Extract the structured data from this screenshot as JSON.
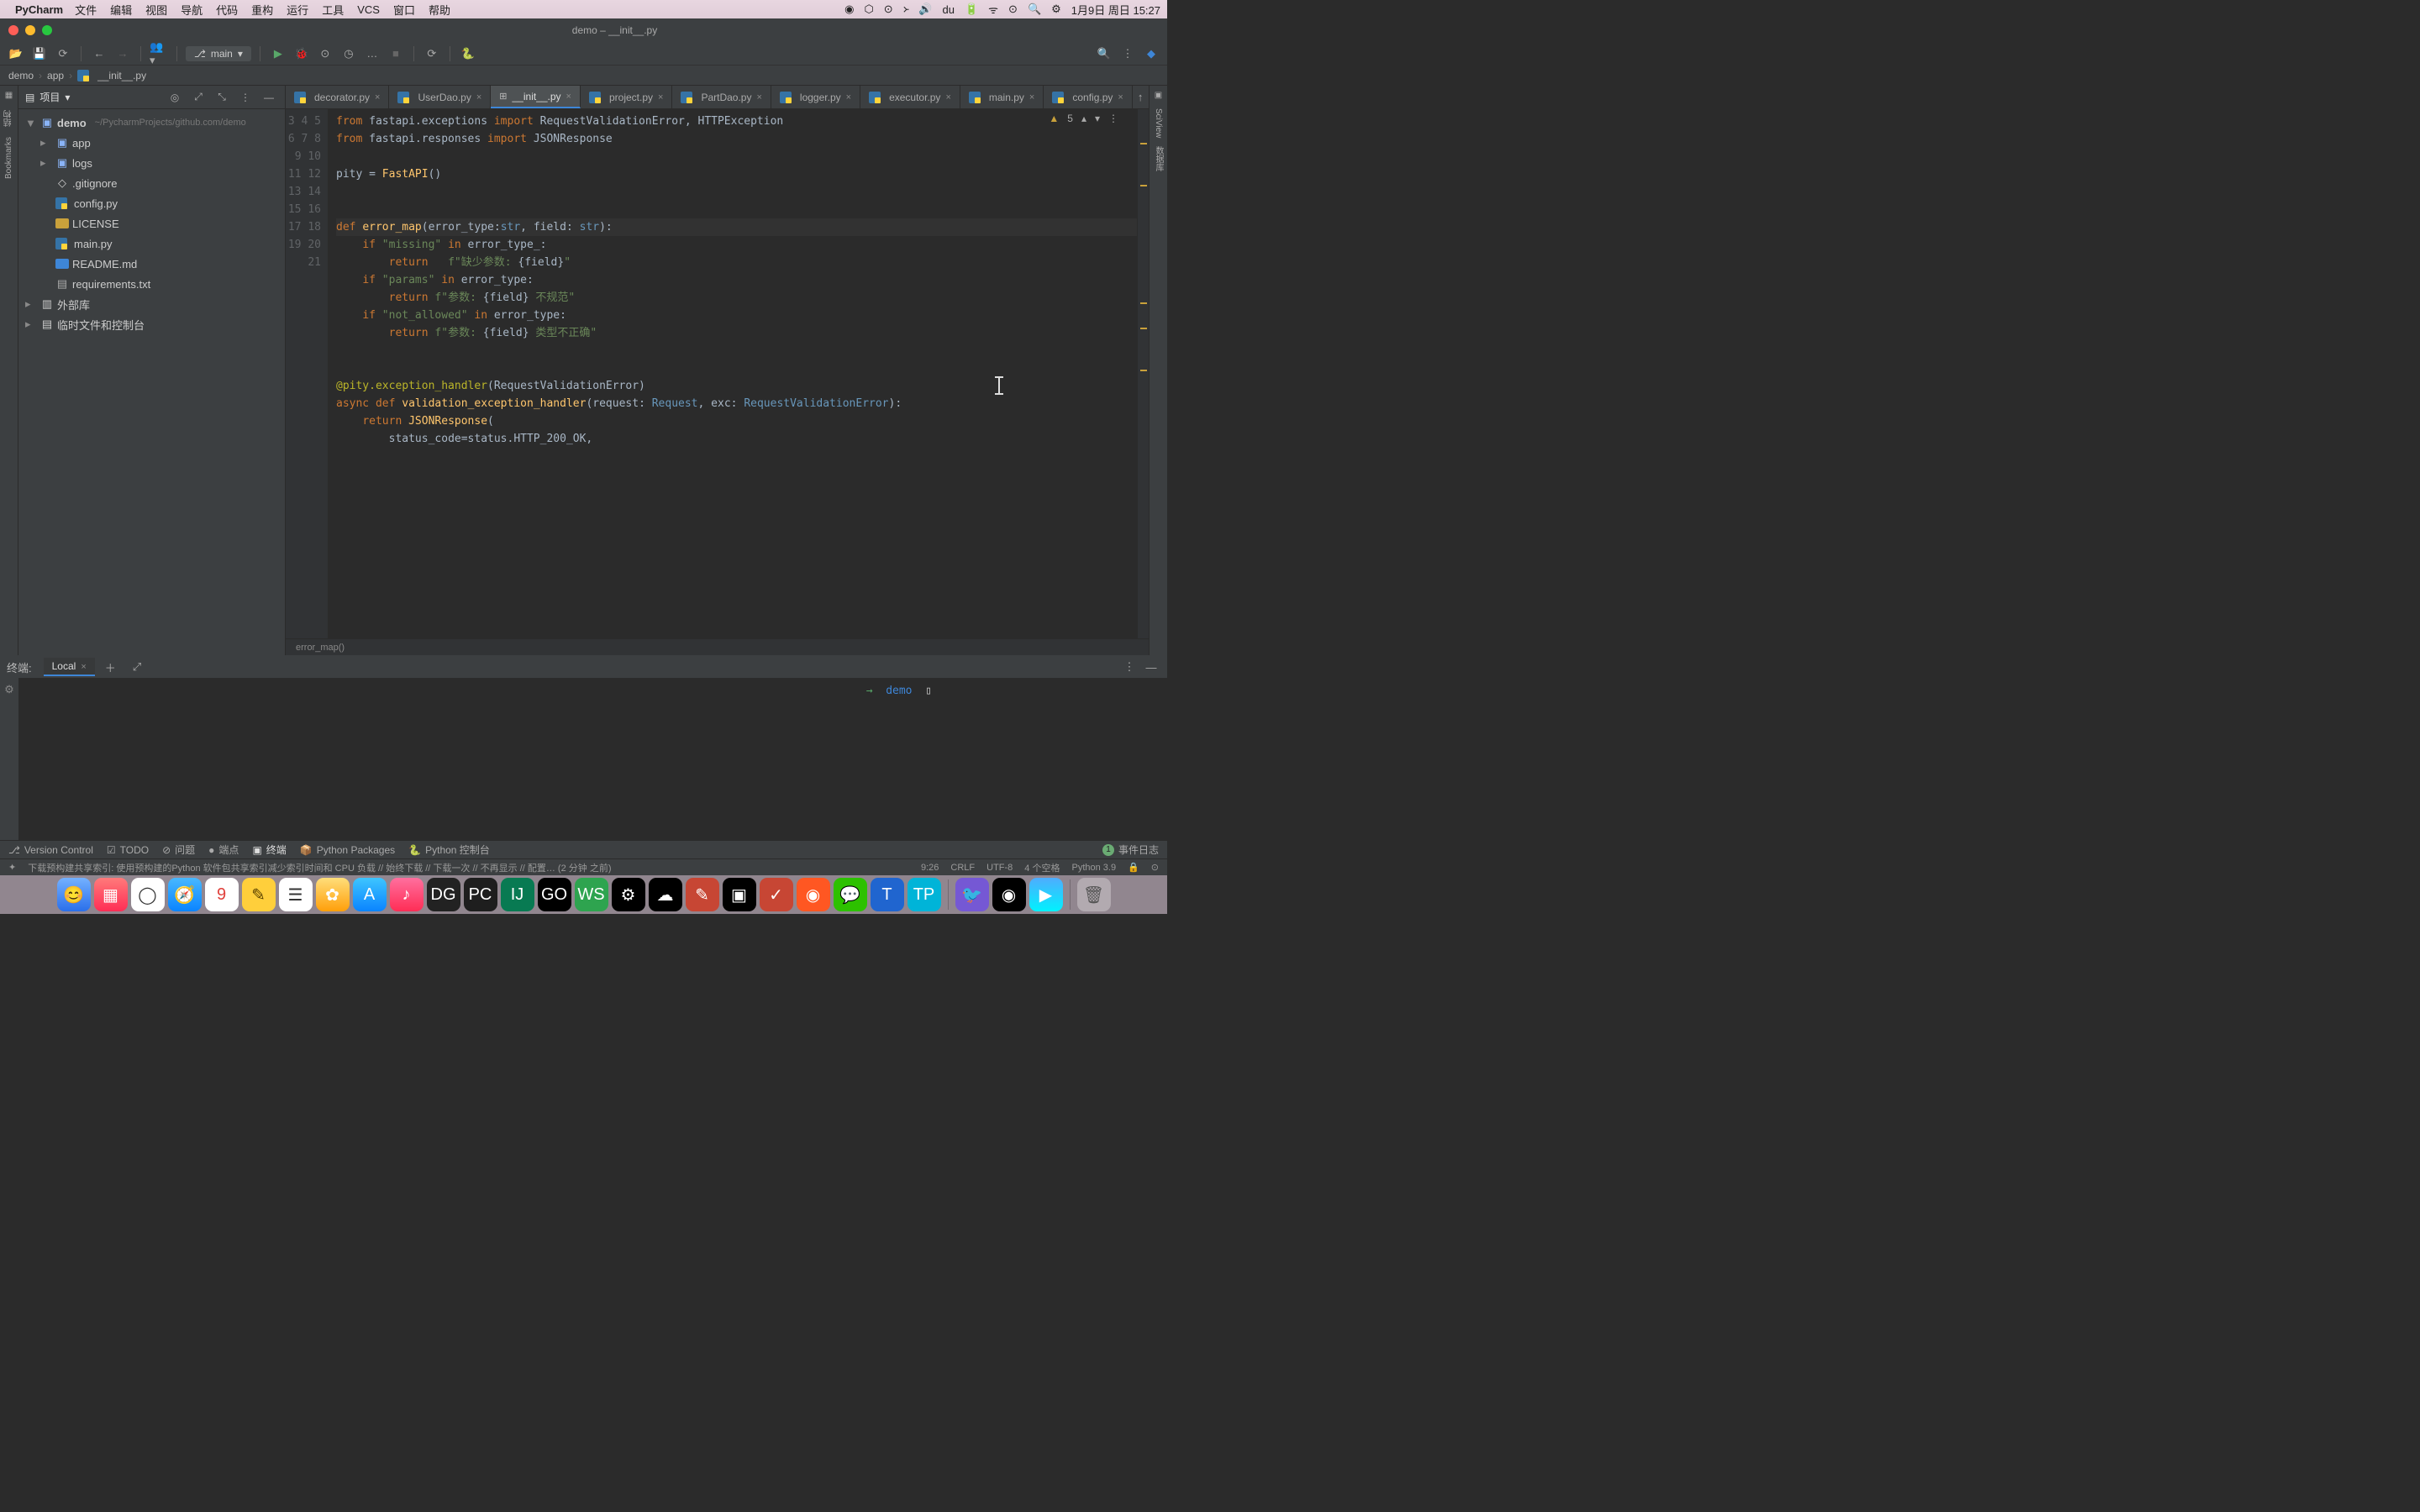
{
  "menubar": {
    "app": "PyCharm",
    "items": [
      "文件",
      "编辑",
      "视图",
      "导航",
      "代码",
      "重构",
      "运行",
      "工具",
      "VCS",
      "窗口",
      "帮助"
    ],
    "clock": "1月9日 周日 15:27"
  },
  "window": {
    "title": "demo – __init__.py"
  },
  "toolbar": {
    "branch": "main"
  },
  "breadcrumbs": {
    "parts": [
      "demo",
      "app",
      "__init__.py"
    ]
  },
  "project": {
    "header": "项目",
    "root": {
      "name": "demo",
      "path": "~/PycharmProjects/github.com/demo"
    },
    "children": [
      {
        "name": "app",
        "kind": "folder"
      },
      {
        "name": "logs",
        "kind": "folder"
      },
      {
        "name": ".gitignore",
        "kind": "file"
      },
      {
        "name": "config.py",
        "kind": "py"
      },
      {
        "name": "LICENSE",
        "kind": "license"
      },
      {
        "name": "main.py",
        "kind": "py"
      },
      {
        "name": "README.md",
        "kind": "md"
      },
      {
        "name": "requirements.txt",
        "kind": "txt"
      }
    ],
    "extra": [
      "外部库",
      "临时文件和控制台"
    ]
  },
  "tabs": [
    "decorator.py",
    "UserDao.py",
    "__init__.py",
    "project.py",
    "PartDao.py",
    "logger.py",
    "executor.py",
    "main.py",
    "config.py"
  ],
  "tabs_active_index": 2,
  "editor": {
    "first_line_no": 3,
    "warnings": "5",
    "trail": "error_map()",
    "lines": [
      {
        "n": 3,
        "html": "<span class='kw'>from</span> fastapi.exceptions <span class='kw'>import</span> RequestValidationError, HTTPException"
      },
      {
        "n": 4,
        "html": "<span class='kw'>from</span> fastapi.responses <span class='kw'>import</span> JSONResponse"
      },
      {
        "n": 5,
        "html": ""
      },
      {
        "n": 6,
        "html": "pity = <span class='id'>FastAPI</span>()"
      },
      {
        "n": 7,
        "html": ""
      },
      {
        "n": 8,
        "html": ""
      },
      {
        "n": 9,
        "html": "<span class='kw'>def</span> <span class='id'>error_map</span>(error_type:<span class='type'>str</span>, field: <span class='type'>str</span>):",
        "hl": true
      },
      {
        "n": 10,
        "html": "    <span class='kw'>if</span> <span class='str'>\"missing\"</span> <span class='kw'>in</span> error_type<span class='param'>_</span>:"
      },
      {
        "n": 11,
        "html": "        <span class='kw'>return</span>   <span class='str'>f\"缺少参数: </span>{<span class='param'>field</span>}<span class='str'>\"</span>"
      },
      {
        "n": 12,
        "html": "    <span class='kw'>if</span> <span class='str'>\"params\"</span> <span class='kw'>in</span> error_type:"
      },
      {
        "n": 13,
        "html": "        <span class='kw'>return</span> <span class='str'>f\"参数: </span>{<span class='param'>field</span>}<span class='str'> 不规范\"</span>"
      },
      {
        "n": 14,
        "html": "    <span class='kw'>if</span> <span class='str'>\"not_allowed\"</span> <span class='kw'>in</span> error_type:"
      },
      {
        "n": 15,
        "html": "        <span class='kw'>return</span> <span class='str'>f\"参数: </span>{<span class='param'>field</span>}<span class='str'> 类型不正确\"</span>"
      },
      {
        "n": 16,
        "html": ""
      },
      {
        "n": 17,
        "html": ""
      },
      {
        "n": 18,
        "html": "<span class='deco'>@pity.exception_handler</span>(RequestValidationError)"
      },
      {
        "n": 19,
        "html": "<span class='kw'>async def</span> <span class='id'>validation_exception_handler</span>(<span class='param'>request</span>: <span class='type'>Request</span>, <span class='param'>exc</span>: <span class='type'>RequestValidationError</span>):"
      },
      {
        "n": 20,
        "html": "    <span class='kw'>return</span> <span class='id'>JSONResponse</span>("
      },
      {
        "n": 21,
        "html": "        <span class='param'>status_code</span>=status.HTTP_200_OK,"
      }
    ]
  },
  "terminal": {
    "title": "终端:",
    "tab": "Local",
    "prompt_arrow": "→",
    "prompt_path": "demo",
    "cursor": "▯"
  },
  "bottom": {
    "items": [
      "Version Control",
      "TODO",
      "问题",
      "端点",
      "终端",
      "Python Packages",
      "Python 控制台"
    ],
    "active_index": 4,
    "right": "事件日志",
    "right_badge": "1"
  },
  "status": {
    "msg": "下载预构建共享索引: 使用预构建的Python 软件包共享索引减少索引时间和 CPU 负载 // 始终下载 // 下载一次 // 不再显示 // 配置… (2 分钟 之前)",
    "pos": "9:26",
    "eol": "CRLF",
    "enc": "UTF-8",
    "indent": "4 个空格",
    "interp": "Python 3.9"
  },
  "leftbar": {
    "labels": [
      "结构",
      "Bookmarks"
    ]
  },
  "rightbar": {
    "labels": [
      "SciView",
      "数据库"
    ]
  }
}
